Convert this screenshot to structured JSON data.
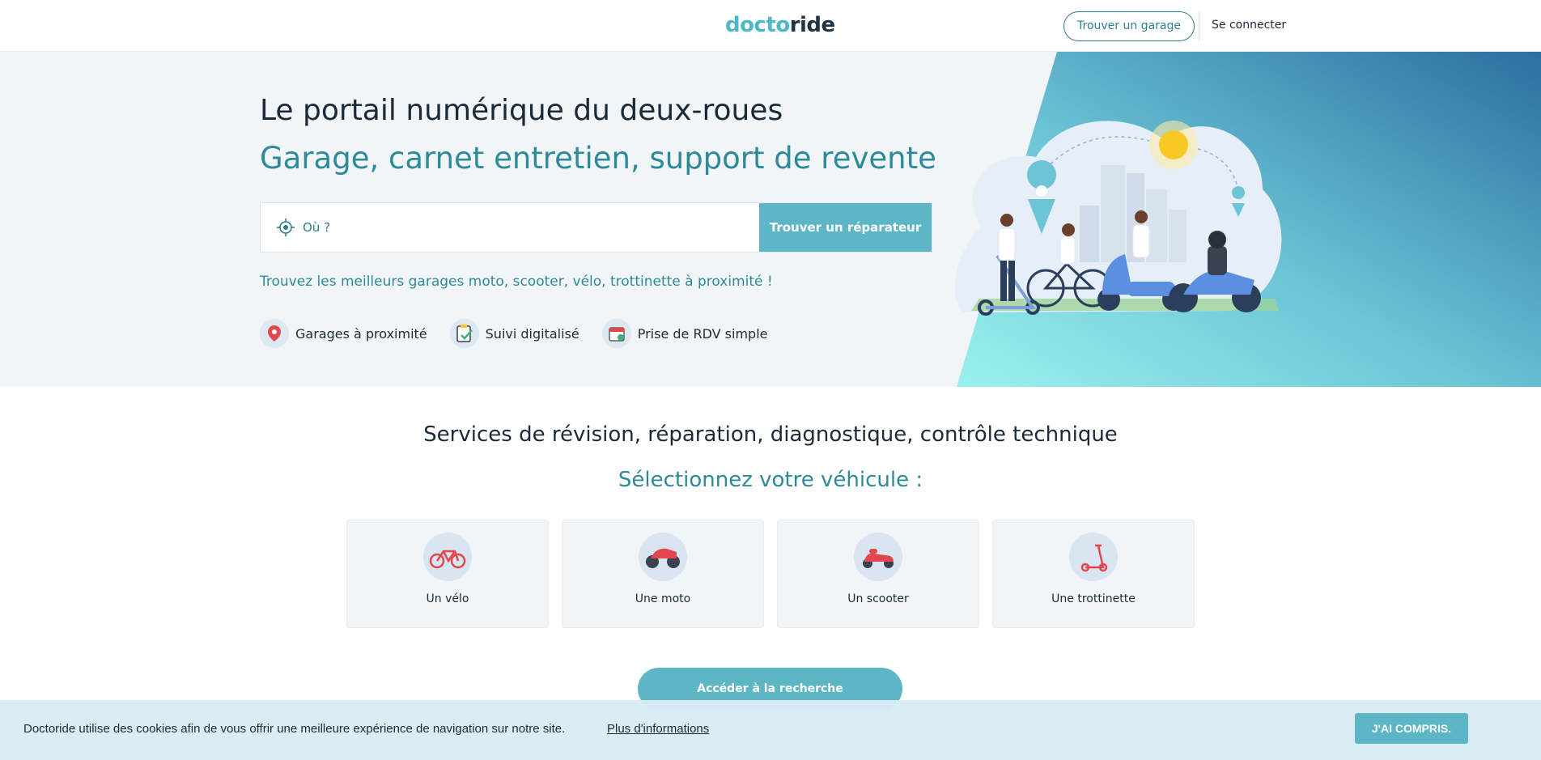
{
  "header": {
    "logo_part1": "docto",
    "logo_part2": "ride",
    "find_garage_label": "Trouver un garage",
    "login_label": "Se connecter"
  },
  "hero": {
    "title": "Le portail numérique du deux-roues",
    "subtitle": "Garage, carnet entretien, support de revente",
    "search_placeholder": "Où ?",
    "search_button": "Trouver un réparateur",
    "tagline": "Trouvez les meilleurs garages moto, scooter, vélo, trottinette à proximité !",
    "features": [
      {
        "label": "Garages à proximité",
        "icon": "map-pin-icon"
      },
      {
        "label": "Suivi digitalisé",
        "icon": "clipboard-check-icon"
      },
      {
        "label": "Prise de RDV simple",
        "icon": "calendar-icon"
      }
    ],
    "gradient_colors": [
      "#9af2ee",
      "#2a6fa0"
    ]
  },
  "services": {
    "title": "Services de révision, réparation, diagnostique, contrôle technique",
    "subtitle": "Sélectionnez votre véhicule :",
    "vehicles": [
      {
        "label": "Un vélo",
        "icon": "bicycle-icon"
      },
      {
        "label": "Une moto",
        "icon": "motorcycle-icon"
      },
      {
        "label": "Un scooter",
        "icon": "scooter-icon"
      },
      {
        "label": "Une trottinette",
        "icon": "kick-scooter-icon"
      }
    ],
    "access_button": "Accéder à la recherche"
  },
  "cookie": {
    "text": "Doctoride utilise des cookies afin de vous offrir une meilleure expérience de navigation sur notre site.",
    "link": "Plus d'informations",
    "button": "J'AI COMPRIS."
  },
  "colors": {
    "accent": "#5cb6c6",
    "teal_text": "#2d8a99",
    "dark_text": "#1b2a3a",
    "vehicle_red": "#e2474e"
  }
}
